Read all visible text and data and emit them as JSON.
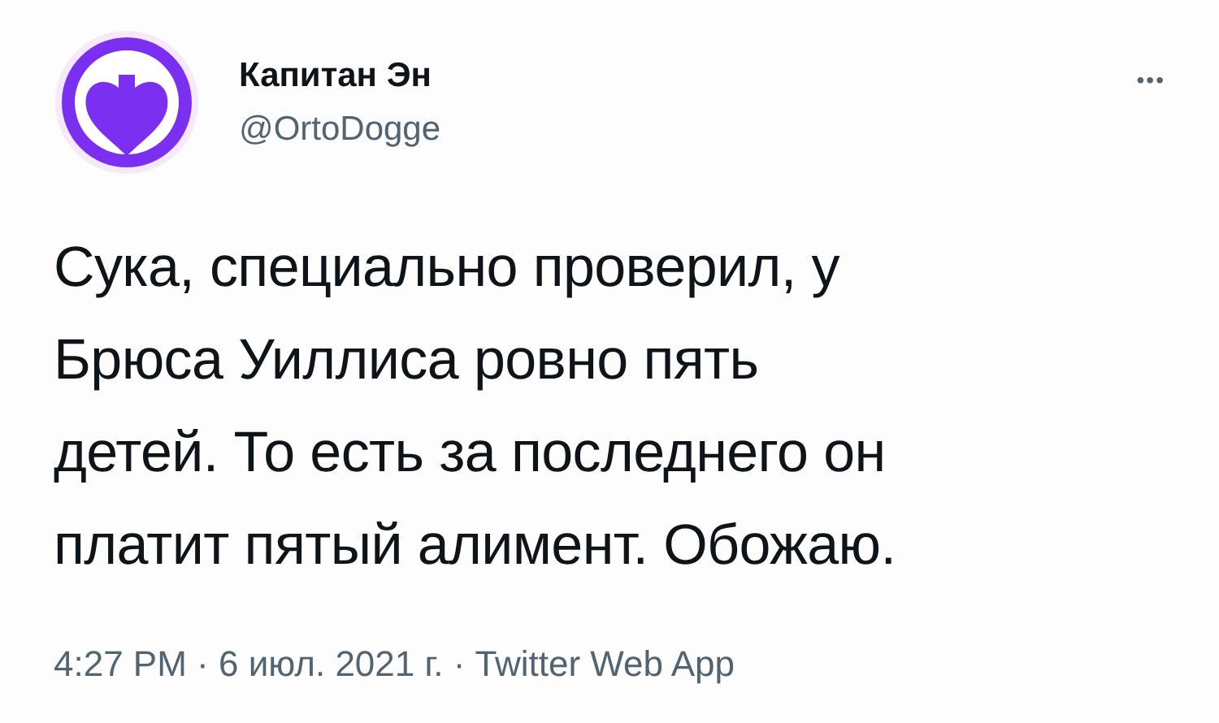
{
  "author": {
    "name": "Капитан Эн",
    "handle": "@OrtoDogge"
  },
  "more_menu": "•••",
  "tweet_lines": [
    "Сука, специально проверил, у",
    "Брюса Уиллиса ровно пять",
    "детей. То есть за последнего он",
    "платит пятый алимент. Обожаю."
  ],
  "meta": "4:27 PM · 6 июл. 2021 г. · Twitter Web App"
}
